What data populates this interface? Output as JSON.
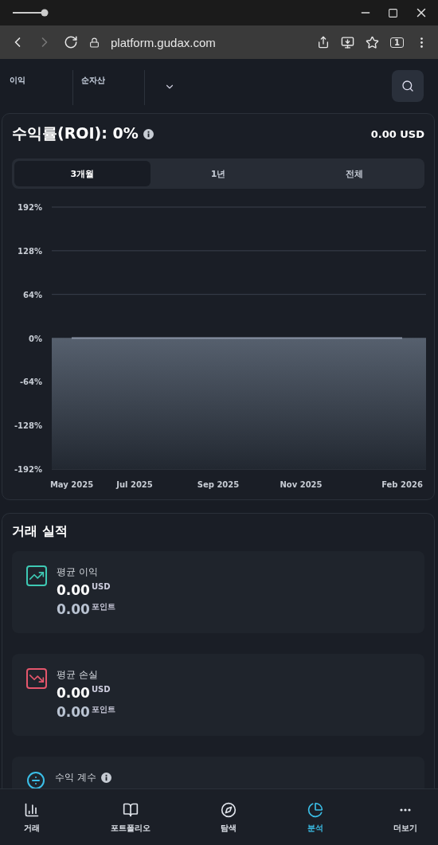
{
  "browser": {
    "url": "platform.gudax.com",
    "tab_count": "1"
  },
  "header": {
    "tabs": [
      {
        "label": "이익"
      },
      {
        "label": "순자산"
      }
    ]
  },
  "roi": {
    "title": "수익률(ROI): 0%",
    "amount": "0.00 USD",
    "periods": [
      {
        "label": "3개월",
        "selected": true
      },
      {
        "label": "1년",
        "selected": false
      },
      {
        "label": "전체",
        "selected": false
      }
    ],
    "chart_data": {
      "type": "line",
      "grid": true,
      "categories": [
        "May 2025",
        "Jul 2025",
        "Sep 2025",
        "Nov 2025",
        "Feb 2026"
      ],
      "series": [
        {
          "color": "#8a94a6",
          "values": [
            0,
            0,
            0,
            0,
            0
          ]
        }
      ],
      "ylim": [
        -192,
        192
      ],
      "yticks": [
        {
          "value": 192,
          "label": "192%"
        },
        {
          "value": 128,
          "label": "128%"
        },
        {
          "value": 64,
          "label": "64%"
        },
        {
          "value": 0,
          "label": "0%"
        },
        {
          "value": -64,
          "label": "-64%"
        },
        {
          "value": -128,
          "label": "-128%"
        },
        {
          "value": -192,
          "label": "-192%"
        }
      ]
    }
  },
  "performance": {
    "title": "거래 실적",
    "cards": [
      {
        "kind": "gain",
        "label": "평균 이익",
        "value": "0.00",
        "unit": "USD",
        "points": "0.00",
        "points_unit": "포인트"
      },
      {
        "kind": "loss",
        "label": "평균 손실",
        "value": "0.00",
        "unit": "USD",
        "points": "0.00",
        "points_unit": "포인트"
      },
      {
        "kind": "factor",
        "label": "수익 계수",
        "info": true
      }
    ]
  },
  "nav": [
    {
      "kind": "trade",
      "label": "거래",
      "selected": false
    },
    {
      "kind": "portfolio",
      "label": "포트폴리오",
      "selected": false
    },
    {
      "kind": "explore",
      "label": "탐색",
      "selected": false
    },
    {
      "kind": "analysis",
      "label": "분석",
      "selected": true
    },
    {
      "kind": "more",
      "label": "더보기",
      "selected": false
    }
  ]
}
